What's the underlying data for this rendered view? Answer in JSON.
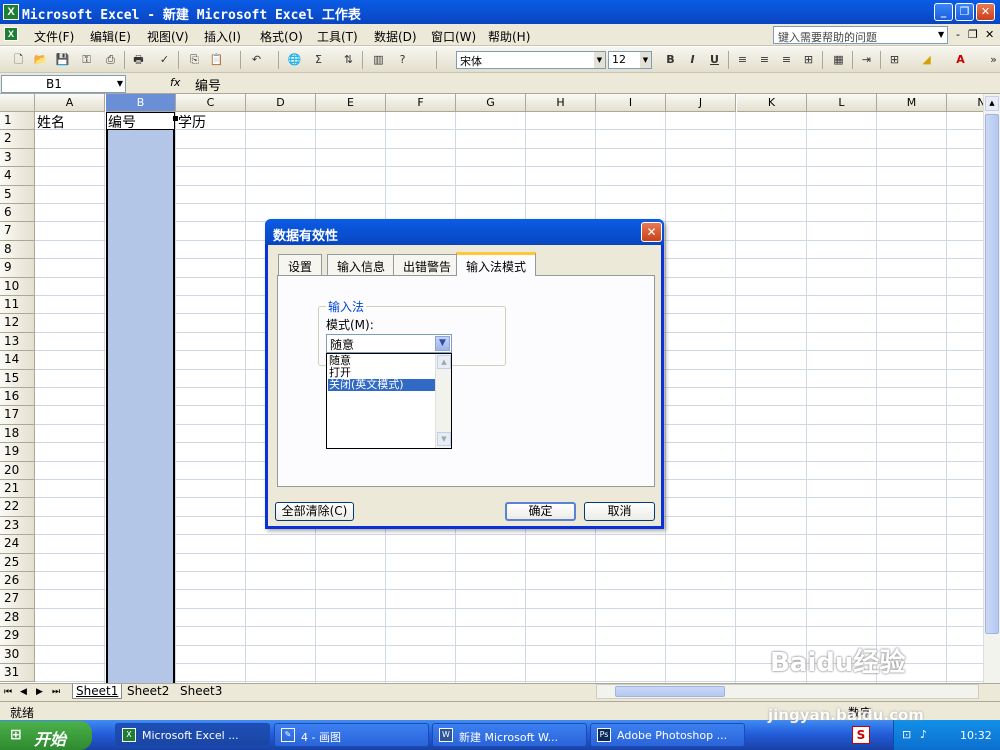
{
  "window": {
    "title": "Microsoft Excel - 新建 Microsoft Excel 工作表"
  },
  "menu": [
    "文件(F)",
    "编辑(E)",
    "视图(V)",
    "插入(I)",
    "格式(O)",
    "工具(T)",
    "数据(D)",
    "窗口(W)",
    "帮助(H)"
  ],
  "help_box": {
    "placeholder": "键入需要帮助的问题"
  },
  "font": {
    "name": "宋体",
    "size": "12"
  },
  "formula_bar": {
    "name_box": "B1",
    "fx": "fx",
    "value": "编号"
  },
  "columns": [
    "A",
    "B",
    "C",
    "D",
    "E",
    "F",
    "G",
    "H",
    "I",
    "J",
    "K",
    "L",
    "M",
    "N"
  ],
  "rows": [
    "1",
    "2",
    "3",
    "4",
    "5",
    "6",
    "7",
    "8",
    "9",
    "10",
    "11",
    "12",
    "13",
    "14",
    "15",
    "16",
    "17",
    "18",
    "19",
    "20",
    "21",
    "22",
    "23",
    "24",
    "25",
    "26",
    "27",
    "28",
    "29",
    "30",
    "31"
  ],
  "cells": {
    "A1": "姓名",
    "B1": "编号",
    "C1": "学历"
  },
  "sheets": [
    "Sheet1",
    "Sheet2",
    "Sheet3"
  ],
  "status": {
    "left": "就绪",
    "right": "数字"
  },
  "dialog": {
    "title": "数据有效性",
    "tabs": [
      "设置",
      "输入信息",
      "出错警告",
      "输入法模式"
    ],
    "group_label": "输入法",
    "mode_label": "模式(M):",
    "mode_value": "随意",
    "options": [
      "随意",
      "打开",
      "关闭(英文模式)"
    ],
    "clear_button": "全部清除(C)",
    "ok_button": "确定",
    "cancel_button": "取消"
  },
  "taskbar": {
    "start": "开始",
    "tasks": [
      "Microsoft Excel ...",
      "4 - 画图",
      "新建 Microsoft W...",
      "Adobe Photoshop ..."
    ],
    "clock": "10:32"
  },
  "watermark": {
    "brand": "Baidu经验",
    "url": "jingyan.baidu.com"
  }
}
